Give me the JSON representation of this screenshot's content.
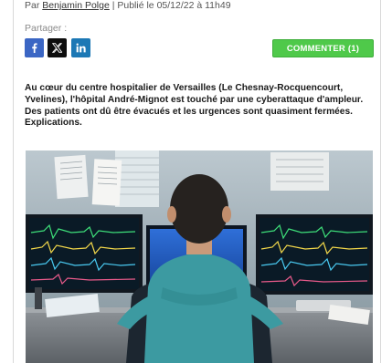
{
  "article": {
    "byline_prefix": "Par ",
    "author": "Benjamin Polge",
    "published": " | Publié le 05/12/22 à 11h49",
    "share_label": "Partager :",
    "comment_label": "COMMENTER",
    "comment_count": "(1)",
    "lede": "Au cœur du centre hospitalier de Versailles (Le Chesnay-Rocquencourt, Yvelines), l'hôpital André-Mignot est touché par une cyberattaque d'ampleur. Des patients ont dû être évacués et les urgences sont quasiment fermées. Explications."
  },
  "social": [
    {
      "name": "facebook-icon",
      "color": "#3b66c4"
    },
    {
      "name": "x-icon",
      "color": "#0d0d0d"
    },
    {
      "name": "linkedin-icon",
      "color": "#1c78b5"
    }
  ],
  "colors": {
    "comment_button": "#4fc94a",
    "author_link": "#333333"
  }
}
